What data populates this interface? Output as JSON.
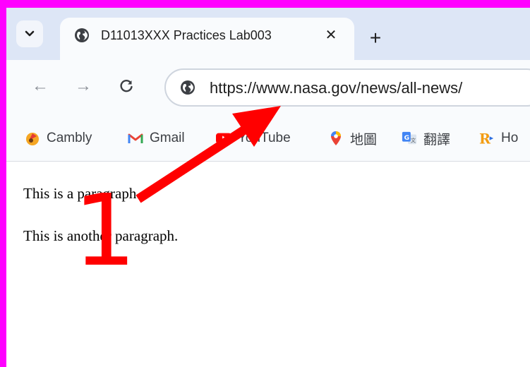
{
  "tab": {
    "title": "D11013XXX Practices Lab003",
    "close_glyph": "✕",
    "favicon": "globe-icon"
  },
  "tabstrip": {
    "dropdown_icon": "chevron-down-icon",
    "new_tab_glyph": "+"
  },
  "toolbar": {
    "back_glyph": "←",
    "forward_glyph": "→",
    "reload_glyph": "C",
    "url": "https://www.nasa.gov/news/all-news/",
    "site_info_icon": "globe-icon"
  },
  "bookmarks": [
    {
      "label": "Cambly",
      "icon": "cambly-icon"
    },
    {
      "label": "Gmail",
      "icon": "gmail-icon"
    },
    {
      "label": "YouTube",
      "icon": "youtube-icon"
    },
    {
      "label": "地圖",
      "icon": "maps-pin-icon"
    },
    {
      "label": "翻譯",
      "icon": "translate-icon"
    },
    {
      "label": "Ho",
      "icon": "r-icon"
    }
  ],
  "page": {
    "paragraphs": [
      "This is a paragraph.",
      "This is another paragraph."
    ]
  },
  "annotation": {
    "number": "1",
    "color": "#ff0000"
  },
  "colors": {
    "frame": "#ff00ff",
    "tabstrip": "#dde6f6",
    "toolbar": "#f9fbfd"
  }
}
